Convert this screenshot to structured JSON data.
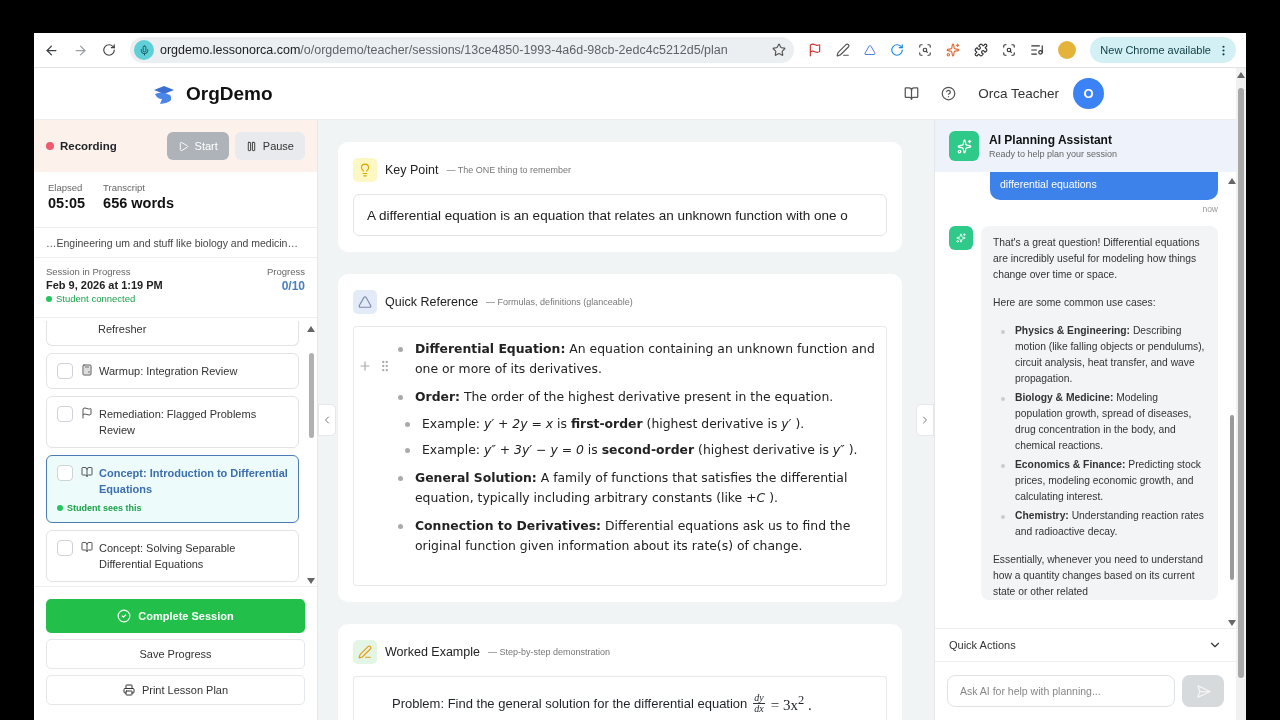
{
  "browser": {
    "url_host": "orgdemo.lessonorca.com",
    "url_path": "/o/orgdemo/teacher/sessions/13ce4850-1993-4a6d-98cb-2edc4c5212d5/plan",
    "update_badge": "New Chrome available"
  },
  "header": {
    "brand": "OrgDemo",
    "user_name": "Orca Teacher",
    "avatar_initial": "O"
  },
  "recording": {
    "status": "Recording",
    "active": true,
    "buttons": [
      {
        "label": "Start",
        "kind": "start",
        "disabled": true
      },
      {
        "label": "Pause",
        "kind": "pause",
        "disabled": false
      }
    ]
  },
  "stats": [
    {
      "label": "Elapsed",
      "value": "05:05"
    },
    {
      "label": "Transcript",
      "value": "656 words"
    }
  ],
  "transcript_snippet": "…Engineering um and stuff like biology and medicin…",
  "session": {
    "status": "Session in Progress",
    "date": "Feb 9, 2026 at 1:19 PM",
    "connection": "Student connected",
    "connected": true,
    "progress_label": "Progress",
    "progress_value": "0/10"
  },
  "lesson_items": [
    {
      "title": "Refresher",
      "kind": "cut",
      "selected": false
    },
    {
      "title": "Warmup: Integration Review",
      "kind": "calculator",
      "checked": false,
      "selected": false
    },
    {
      "title": "Remediation: Flagged Problems Review",
      "kind": "flag",
      "checked": false,
      "selected": false
    },
    {
      "title": "Concept: Introduction to Differential Equations",
      "kind": "book",
      "checked": false,
      "selected": true,
      "note": "Student sees this"
    },
    {
      "title": "Concept: Solving Separable Differential Equations",
      "kind": "book",
      "checked": false,
      "selected": false
    }
  ],
  "actions": [
    {
      "label": "Complete Session",
      "kind": "primary"
    },
    {
      "label": "Save Progress",
      "kind": "plain"
    },
    {
      "label": "Print Lesson Plan",
      "kind": "print"
    }
  ],
  "sections": [
    {
      "kind": "key_point",
      "title": "Key Point",
      "subtitle": "— The ONE thing to remember",
      "body": "A differential equation is an equation that relates an unknown function with one o"
    },
    {
      "kind": "quick_reference",
      "title": "Quick Reference",
      "subtitle": "— Formulas, definitions (glanceable)",
      "bullets": [
        {
          "text": "**Differential Equation:** An equation containing an unknown function and one or more of its derivatives."
        },
        {
          "text": "**Order:** The order of the highest derivative present in the equation.",
          "children": [
            {
              "text": "Example: *y′ + 2y = x* is **first-order** (highest derivative is *y′* )."
            },
            {
              "text": "Example: *y″ + 3y′ − y = 0* is **second-order** (highest derivative is *y″* )."
            }
          ]
        },
        {
          "text": "**General Solution:** A family of functions that satisfies the differential equation, typically including arbitrary constants (like *+C* )."
        },
        {
          "text": "**Connection to Derivatives:** Differential equations ask us to find the original function given information about its rate(s) of change."
        }
      ]
    },
    {
      "kind": "worked_example",
      "title": "Worked Example",
      "subtitle": "— Step-by-step demonstration",
      "problem": {
        "lead": "Problem: Find the general solution for the differential equation",
        "numerator": "dy",
        "denominator": "dx",
        "rest": "= 3x$^{2}$ ."
      }
    }
  ],
  "assistant": {
    "title": "AI Planning Assistant",
    "subtitle": "Ready to help plan your session",
    "messages": [
      {
        "kind": "user",
        "text": "differential equations",
        "time": "now"
      },
      {
        "kind": "assistant",
        "blocks": [
          {
            "kind": "paragraph",
            "text": "That's a great question! Differential equations are incredibly useful for modeling how things change over time or space."
          },
          {
            "kind": "paragraph",
            "text": "Here are some common use cases:"
          },
          {
            "kind": "list",
            "items": [
              "**Physics & Engineering:** Describing motion (like falling objects or pendulums), circuit analysis, heat transfer, and wave propagation.",
              "**Biology & Medicine:** Modeling population growth, spread of diseases, drug concentration in the body, and chemical reactions.",
              "**Economics & Finance:** Predicting stock prices, modeling economic growth, and calculating interest.",
              "**Chemistry:** Understanding reaction rates and radioactive decay."
            ]
          },
          {
            "kind": "paragraph",
            "text": "Essentially, whenever you need to understand how a quantity changes based on its current state or other related"
          }
        ]
      }
    ],
    "quick_actions": {
      "label": "Quick Actions",
      "expanded": false
    },
    "input_placeholder": "Ask AI for help with planning..."
  }
}
